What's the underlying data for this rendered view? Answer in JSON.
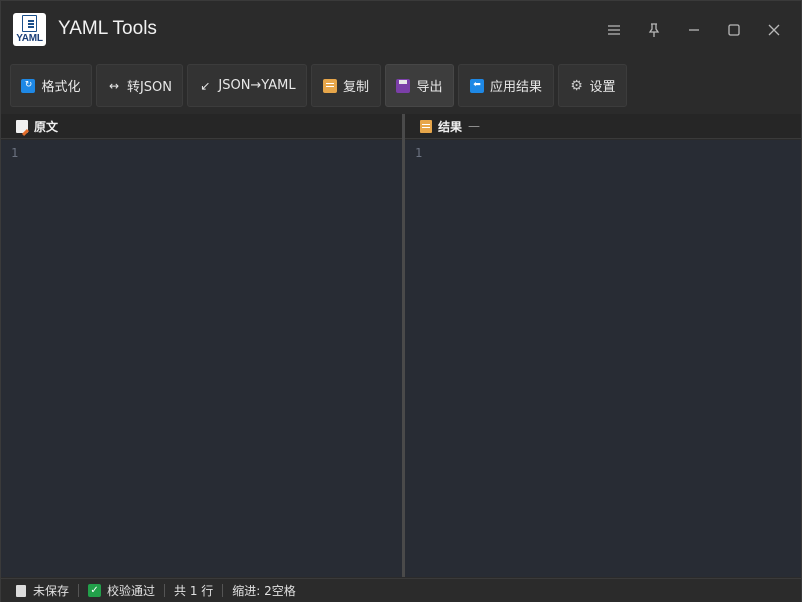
{
  "app": {
    "title": "YAML Tools",
    "logo_text": "YAML"
  },
  "window_controls": {
    "menu_icon": "hamburger-icon",
    "pin_icon": "pin-icon",
    "minimize_icon": "minimize-icon",
    "maximize_icon": "maximize-icon",
    "close_icon": "close-icon"
  },
  "toolbar": {
    "format_label": "格式化",
    "to_json_label": "转JSON",
    "to_json_icon": "↔",
    "json_to_yaml_label": "JSON→YAML",
    "json_to_yaml_icon": "↙",
    "copy_label": "复制",
    "export_label": "导出",
    "apply_label": "应用结果",
    "settings_label": "设置"
  },
  "panes": {
    "source": {
      "title": "原文",
      "line_numbers": [
        "1"
      ]
    },
    "result": {
      "title": "结果",
      "suffix": "—",
      "line_numbers": [
        "1"
      ]
    }
  },
  "status": {
    "save_state": "未保存",
    "validation": "校验通过",
    "line_count": "共 1 行",
    "indent": "缩进: 2空格"
  },
  "colors": {
    "window_bg": "#2b2b2b",
    "editor_bg": "#282c34",
    "accent_blue": "#1e88e5",
    "success_green": "#22a04a"
  }
}
